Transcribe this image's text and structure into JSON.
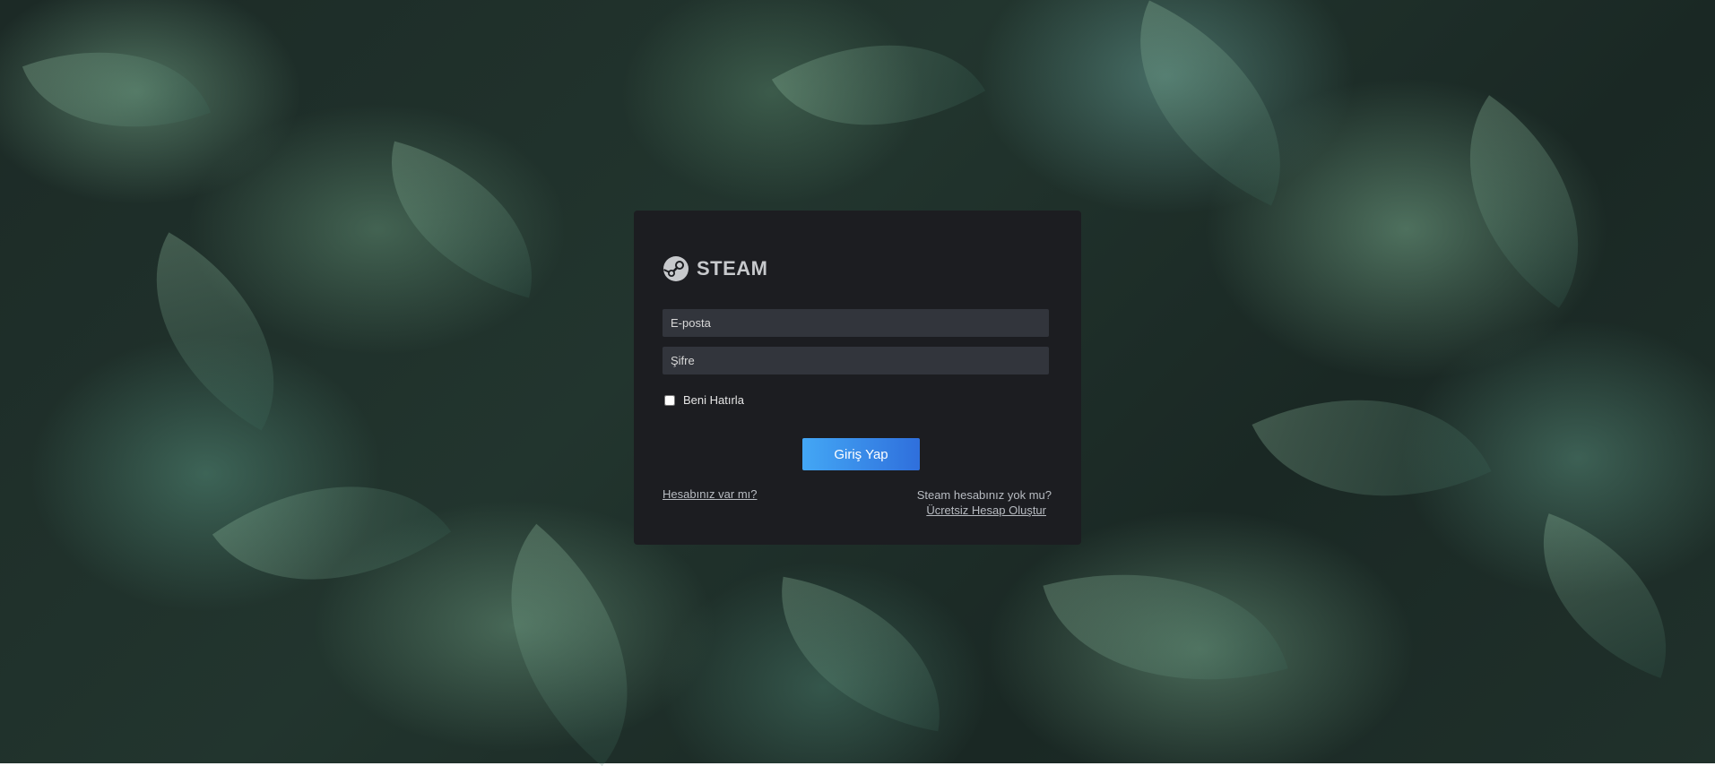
{
  "brand": {
    "name": "STEAM",
    "icon": "steam-logo-icon"
  },
  "form": {
    "email_placeholder": "E-posta",
    "password_placeholder": "Şifre",
    "remember_label": "Beni Hatırla",
    "submit_label": "Giriş Yap"
  },
  "links": {
    "have_account": "Hesabınız var mı?",
    "no_account_text": "Steam hesabınız yok mu?",
    "create_account": "Ücretsiz Hesap Oluştur"
  },
  "colors": {
    "card_bg": "#1c1d21",
    "field_bg": "#32353c",
    "button_start": "#43a7f5",
    "button_end": "#2f6fdc"
  }
}
